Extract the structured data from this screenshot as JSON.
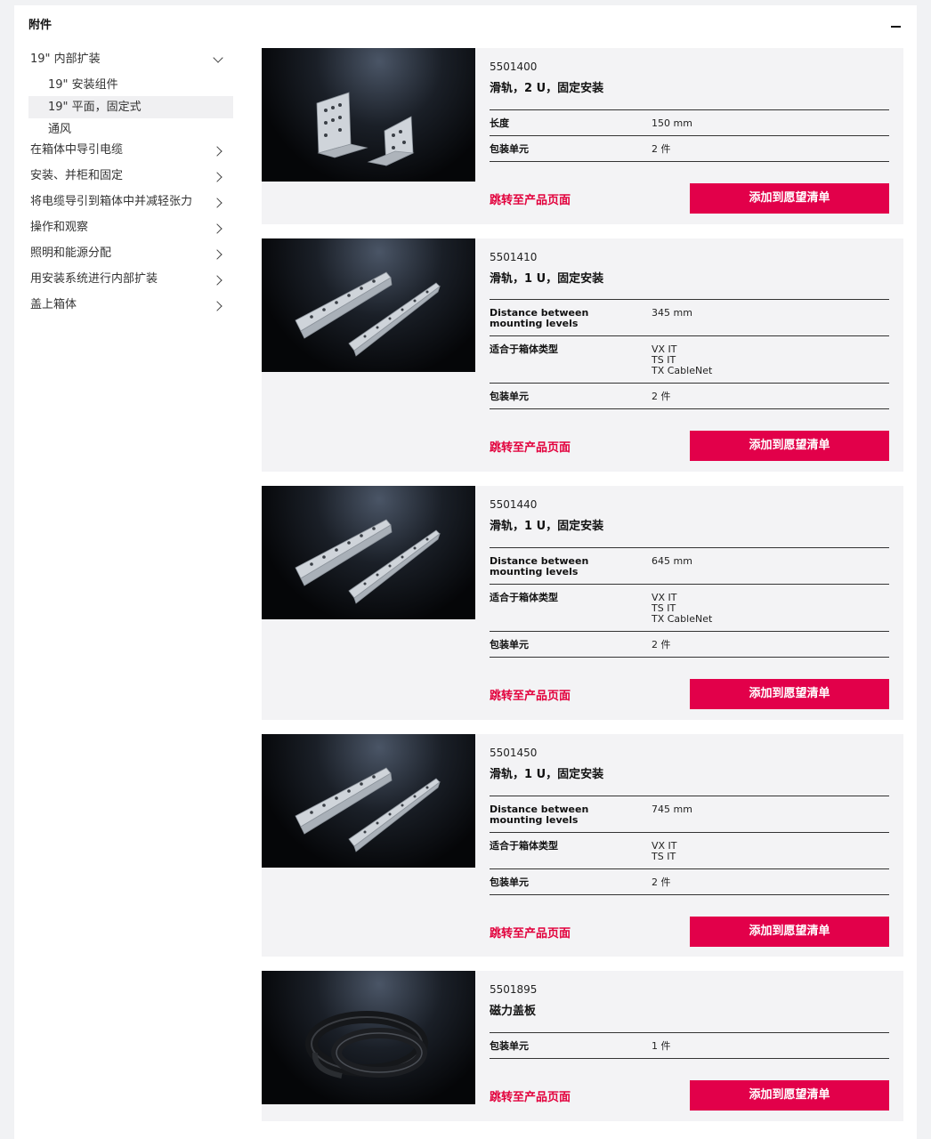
{
  "panel": {
    "title": "附件"
  },
  "sidebar": {
    "expanded": {
      "label": "19\" 内部扩装"
    },
    "subitems": [
      {
        "label": "19\" 安装组件"
      },
      {
        "label": "19\" 平面，固定式"
      },
      {
        "label": "通风"
      }
    ],
    "items": [
      {
        "label": "在箱体中导引电缆"
      },
      {
        "label": "安装、并柜和固定"
      },
      {
        "label": "将电缆导引到箱体中并减轻张力"
      },
      {
        "label": "操作和观察"
      },
      {
        "label": "照明和能源分配"
      },
      {
        "label": "用安装系统进行内部扩装"
      },
      {
        "label": "盖上箱体"
      }
    ]
  },
  "product_link_label": "跳转至产品页面",
  "wishlist_label": "添加到愿望清单",
  "products": [
    {
      "artno": "5501400",
      "name": "滑轨，2 U，固定安装",
      "specs": [
        {
          "k": "长度",
          "v": [
            "150 mm"
          ]
        },
        {
          "k": "包装单元",
          "v": [
            "2 件"
          ]
        }
      ]
    },
    {
      "artno": "5501410",
      "name": "滑轨，1 U，固定安装",
      "specs": [
        {
          "k": "Distance between mounting levels",
          "v": [
            "345 mm"
          ]
        },
        {
          "k": "适合于箱体类型",
          "v": [
            "VX IT",
            "TS IT",
            "TX CableNet"
          ]
        },
        {
          "k": "包装单元",
          "v": [
            "2 件"
          ]
        }
      ]
    },
    {
      "artno": "5501440",
      "name": "滑轨，1 U，固定安装",
      "specs": [
        {
          "k": "Distance between mounting levels",
          "v": [
            "645 mm"
          ]
        },
        {
          "k": "适合于箱体类型",
          "v": [
            "VX IT",
            "TS IT",
            "TX CableNet"
          ]
        },
        {
          "k": "包装单元",
          "v": [
            "2 件"
          ]
        }
      ]
    },
    {
      "artno": "5501450",
      "name": "滑轨，1 U，固定安装",
      "specs": [
        {
          "k": "Distance between mounting levels",
          "v": [
            "745 mm"
          ]
        },
        {
          "k": "适合于箱体类型",
          "v": [
            "VX IT",
            "TS IT"
          ]
        },
        {
          "k": "包装单元",
          "v": [
            "2 件"
          ]
        }
      ]
    },
    {
      "artno": "5501895",
      "name": "磁力盖板",
      "specs": [
        {
          "k": "包装单元",
          "v": [
            "1 件"
          ]
        }
      ]
    }
  ]
}
